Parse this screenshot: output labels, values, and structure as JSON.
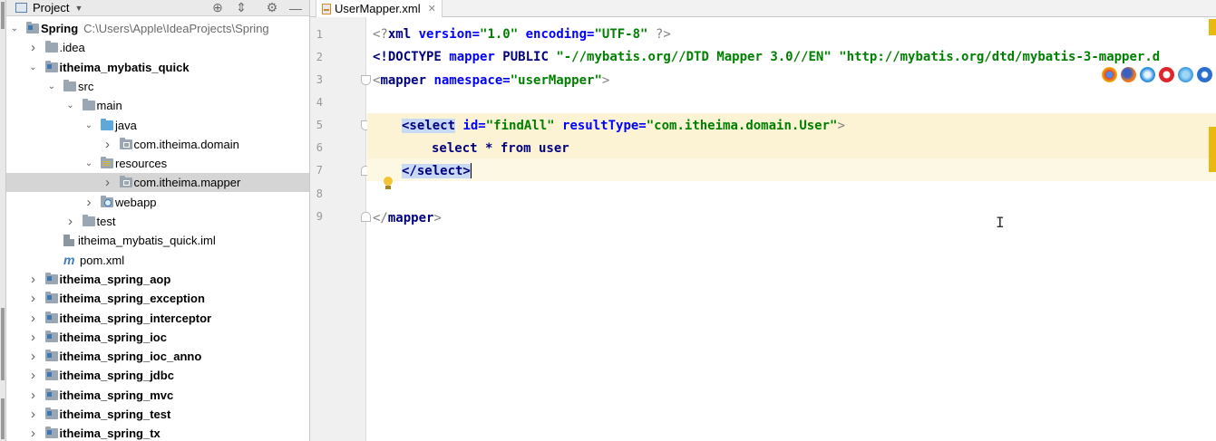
{
  "project_panel": {
    "title": "Project",
    "tree": [
      {
        "label": "Spring",
        "path": "C:\\Users\\Apple\\IdeaProjects\\Spring",
        "bold": true,
        "arrow": "down",
        "icon": "folder-module",
        "depth": 0
      },
      {
        "label": ".idea",
        "bold": false,
        "arrow": "right",
        "icon": "folder",
        "depth": 1
      },
      {
        "label": "itheima_mybatis_quick",
        "bold": true,
        "arrow": "down",
        "icon": "folder-module",
        "depth": 1
      },
      {
        "label": "src",
        "bold": false,
        "arrow": "down",
        "icon": "folder",
        "depth": 2
      },
      {
        "label": "main",
        "bold": false,
        "arrow": "down",
        "icon": "folder",
        "depth": 3
      },
      {
        "label": "java",
        "bold": false,
        "arrow": "down",
        "icon": "folder-blue",
        "depth": 4
      },
      {
        "label": "com.itheima.domain",
        "bold": false,
        "arrow": "right",
        "icon": "folder-package",
        "depth": 5
      },
      {
        "label": "resources",
        "bold": false,
        "arrow": "down",
        "icon": "folder-resources",
        "depth": 4
      },
      {
        "label": "com.itheima.mapper",
        "bold": false,
        "arrow": "right",
        "icon": "folder-package",
        "depth": 5,
        "selected": true
      },
      {
        "label": "webapp",
        "bold": false,
        "arrow": "right",
        "icon": "folder-web",
        "depth": 4
      },
      {
        "label": "test",
        "bold": false,
        "arrow": "right",
        "icon": "folder",
        "depth": 3
      },
      {
        "label": "itheima_mybatis_quick.iml",
        "bold": false,
        "arrow": "",
        "icon": "file-iml",
        "depth": 2
      },
      {
        "label": "pom.xml",
        "bold": false,
        "arrow": "",
        "icon": "file-maven",
        "depth": 2
      },
      {
        "label": "itheima_spring_aop",
        "bold": true,
        "arrow": "right",
        "icon": "folder-module",
        "depth": 1
      },
      {
        "label": "itheima_spring_exception",
        "bold": true,
        "arrow": "right",
        "icon": "folder-module",
        "depth": 1
      },
      {
        "label": "itheima_spring_interceptor",
        "bold": true,
        "arrow": "right",
        "icon": "folder-module",
        "depth": 1
      },
      {
        "label": "itheima_spring_ioc",
        "bold": true,
        "arrow": "right",
        "icon": "folder-module",
        "depth": 1
      },
      {
        "label": "itheima_spring_ioc_anno",
        "bold": true,
        "arrow": "right",
        "icon": "folder-module",
        "depth": 1
      },
      {
        "label": "itheima_spring_jdbc",
        "bold": true,
        "arrow": "right",
        "icon": "folder-module",
        "depth": 1
      },
      {
        "label": "itheima_spring_mvc",
        "bold": true,
        "arrow": "right",
        "icon": "folder-module",
        "depth": 1
      },
      {
        "label": "itheima_spring_test",
        "bold": true,
        "arrow": "right",
        "icon": "folder-module",
        "depth": 1
      },
      {
        "label": "itheima_spring_tx",
        "bold": true,
        "arrow": "right",
        "icon": "folder-module",
        "depth": 1
      }
    ]
  },
  "editor": {
    "tab_label": "UserMapper.xml",
    "line_numbers": [
      "1",
      "2",
      "3",
      "4",
      "5",
      "6",
      "7",
      "8",
      "9"
    ],
    "code": {
      "l1_decl": "<?",
      "l1_name": "xml",
      "l1_a1": " version=",
      "l1_v1": "\"1.0\"",
      "l1_a2": " encoding=",
      "l1_v2": "\"UTF-8\"",
      "l1_end": " ?>",
      "l2_open": "<!DOCTYPE",
      "l2_name": " mapper",
      "l2_public": " PUBLIC",
      "l2_v1": " \"-//mybatis.org//DTD Mapper 3.0//EN\"",
      "l2_v2": " \"http://mybatis.org/dtd/mybatis-3-mapper.d",
      "l3_lt": "<",
      "l3_tag": "mapper",
      "l3_attr": " namespace=",
      "l3_val": "\"userMapper\"",
      "l3_gt": ">",
      "l5_open": "<select",
      "l5_a1": " id=",
      "l5_v1": "\"findAll\"",
      "l5_a2": " resultType=",
      "l5_v2": "\"com.itheima.domain.User\"",
      "l5_gt": ">",
      "l6_sql": "select * from user",
      "l7_close": "</select>",
      "l9_lt": "</",
      "l9_tag": "mapper",
      "l9_gt": ">"
    }
  },
  "colors": {
    "highlight_block": "#fbf3d3",
    "tag": "#000080",
    "attribute": "#0000ff",
    "value": "#008000",
    "warning_mark": "#e8b90f"
  },
  "icons": [
    "project-icon",
    "chevron-down-icon",
    "globe-icon",
    "collapse-icon",
    "gear-icon",
    "minimize-icon",
    "xml-file-icon",
    "close-icon",
    "lightbulb-icon",
    "chrome-icon",
    "firefox-icon",
    "safari-icon",
    "opera-icon",
    "ie-icon",
    "edge-icon"
  ]
}
